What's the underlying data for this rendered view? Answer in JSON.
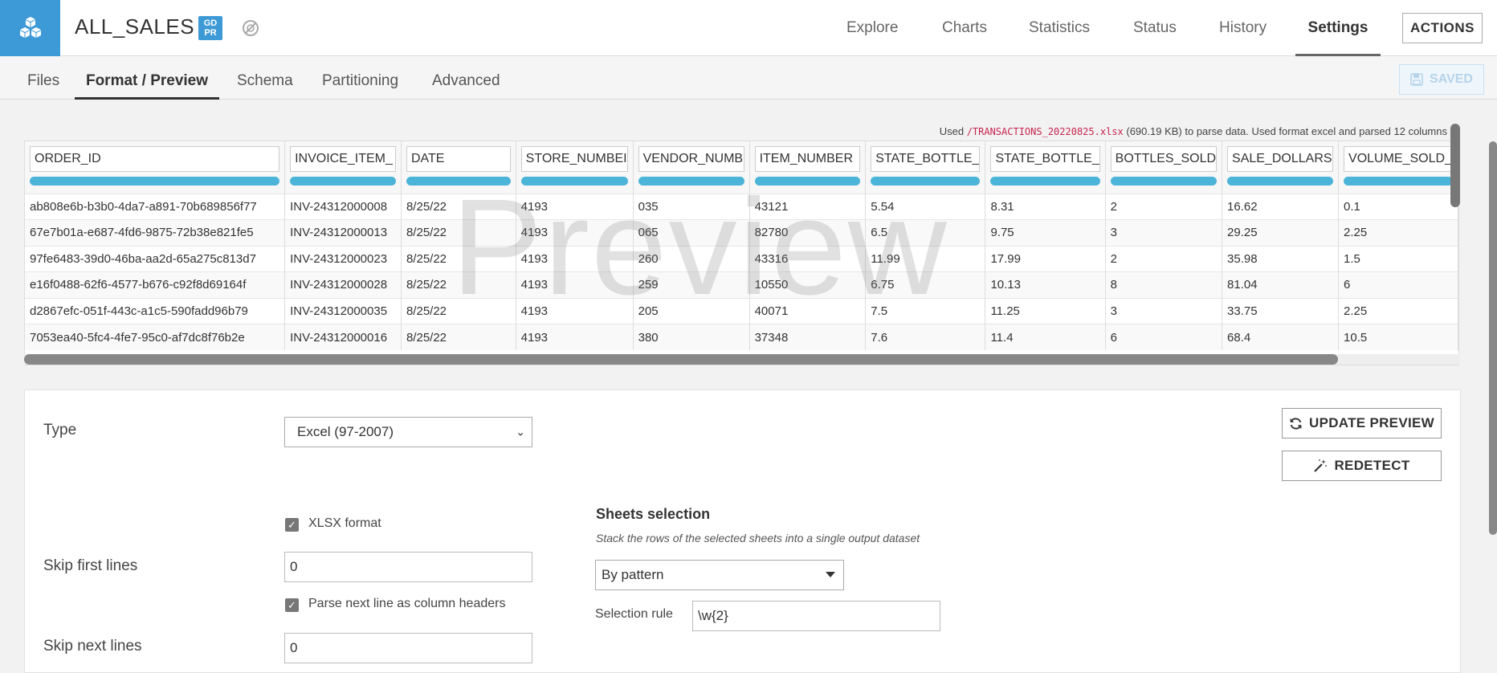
{
  "header": {
    "dataset_name": "ALL_SALES",
    "gdpr_badge": [
      "GD",
      "PR"
    ],
    "nav": [
      "Explore",
      "Charts",
      "Statistics",
      "Status",
      "History",
      "Settings"
    ],
    "active_nav": "Settings",
    "actions_label": "ACTIONS"
  },
  "subnav": {
    "tabs": [
      "Files",
      "Format / Preview",
      "Schema",
      "Partitioning",
      "Advanced"
    ],
    "active_tab": "Format / Preview",
    "saved_label": "SAVED"
  },
  "info": {
    "prefix": "Used ",
    "file": "/TRANSACTIONS_20220825.xlsx",
    "suffix": " (690.19 KB) to parse data. Used format excel and parsed 12 columns"
  },
  "preview": {
    "watermark": "Preview",
    "columns": [
      "ORDER_ID",
      "INVOICE_ITEM_",
      "DATE",
      "STORE_NUMBEI",
      "VENDOR_NUMB",
      "ITEM_NUMBER",
      "STATE_BOTTLE_",
      "STATE_BOTTLE_",
      "BOTTLES_SOLD",
      "SALE_DOLLARS",
      "VOLUME_SOLD_"
    ],
    "rows": [
      [
        "ab808e6b-b3b0-4da7-a891-70b689856f77",
        "INV-24312000008",
        "8/25/22",
        "4193",
        "035",
        "43121",
        "5.54",
        "8.31",
        "2",
        "16.62",
        "0.1"
      ],
      [
        "67e7b01a-e687-4fd6-9875-72b38e821fe5",
        "INV-24312000013",
        "8/25/22",
        "4193",
        "065",
        "82780",
        "6.5",
        "9.75",
        "3",
        "29.25",
        "2.25"
      ],
      [
        "97fe6483-39d0-46ba-aa2d-65a275c813d7",
        "INV-24312000023",
        "8/25/22",
        "4193",
        "260",
        "43316",
        "11.99",
        "17.99",
        "2",
        "35.98",
        "1.5"
      ],
      [
        "e16f0488-62f6-4577-b676-c92f8d69164f",
        "INV-24312000028",
        "8/25/22",
        "4193",
        "259",
        "10550",
        "6.75",
        "10.13",
        "8",
        "81.04",
        "6"
      ],
      [
        "d2867efc-051f-443c-a1c5-590fadd96b79",
        "INV-24312000035",
        "8/25/22",
        "4193",
        "205",
        "40071",
        "7.5",
        "11.25",
        "3",
        "33.75",
        "2.25"
      ],
      [
        "7053ea40-5fc4-4fe7-95c0-af7dc8f76b2e",
        "INV-24312000016",
        "8/25/22",
        "4193",
        "380",
        "37348",
        "7.6",
        "11.4",
        "6",
        "68.4",
        "10.5"
      ]
    ]
  },
  "settings": {
    "type_label": "Type",
    "type_value": "Excel (97-2007)",
    "update_preview_label": "UPDATE PREVIEW",
    "redetect_label": "REDETECT",
    "xlsx_label": "XLSX format",
    "xlsx_checked": true,
    "skip_first_label": "Skip first lines",
    "skip_first_value": "0",
    "parse_header_label": "Parse next line as column headers",
    "parse_header_checked": true,
    "skip_next_label": "Skip next lines",
    "skip_next_value": "0",
    "sheets_title": "Sheets selection",
    "sheets_subtitle": "Stack the rows of the selected sheets into a single output dataset",
    "sheets_mode": "By pattern",
    "selection_rule_label": "Selection rule",
    "selection_rule_value": "\\w{2}"
  },
  "colors": {
    "brand": "#3d9ad6",
    "column_bar": "#4cb4d8",
    "file_path": "#c7254e"
  }
}
